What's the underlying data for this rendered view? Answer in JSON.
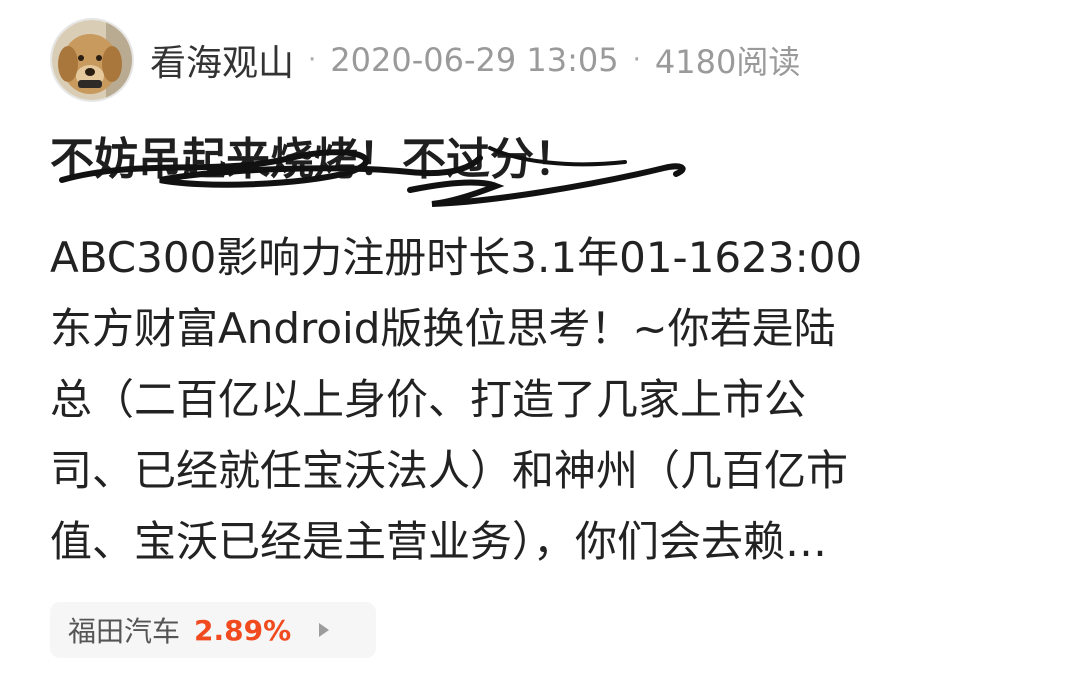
{
  "post": {
    "author": "看海观山",
    "separator": "·",
    "timestamp": "2020-06-29 13:05",
    "read_count": "4180阅读",
    "title": "不妨吊起来烧烤！不过分！",
    "body_lines": [
      "ABC300影响力注册时长3.1年01-1623:00",
      "东方财富Android版换位思考！~你若是陆",
      "总（二百亿以上身价、打造了几家上市公",
      "司、已经就任宝沃法人）和神州（几百亿市",
      "值、宝沃已经是主营业务），你们会去赖…"
    ]
  },
  "stock_tag": {
    "name": "福田汽车",
    "change": "2.89%",
    "change_color": "#f04a1e"
  },
  "icons": {
    "avatar": "golden-retriever-puppy",
    "chip_arrow": "play-arrow-icon",
    "title_overlay": "black-scribble"
  }
}
